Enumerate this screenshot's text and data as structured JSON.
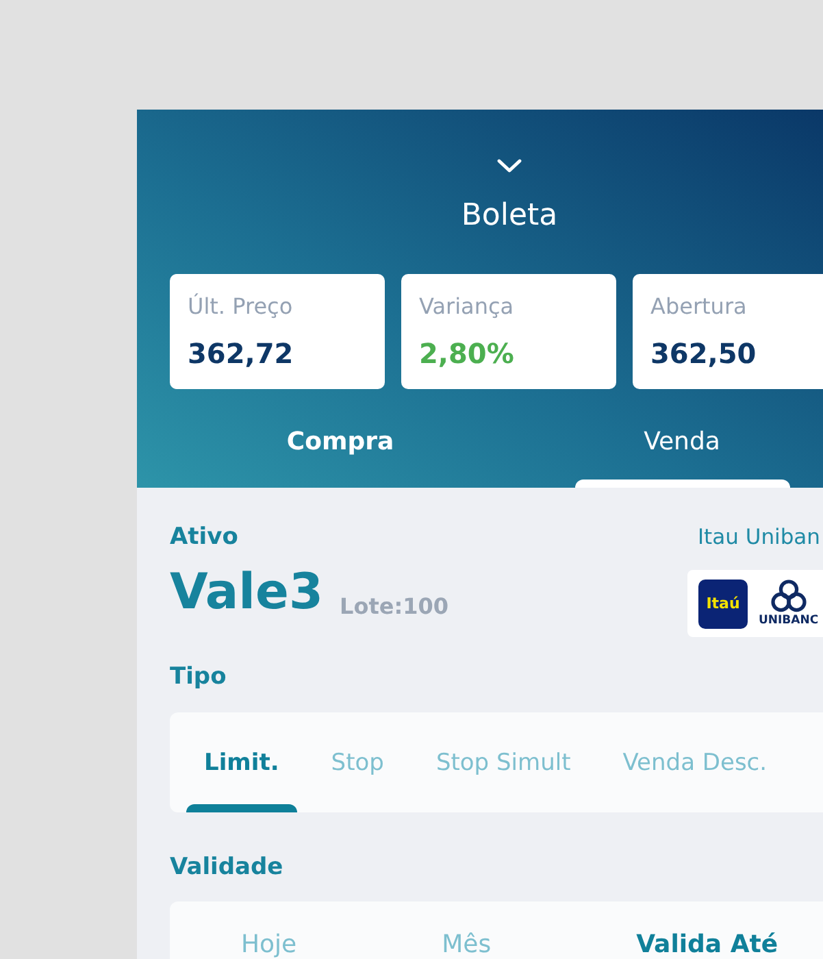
{
  "header": {
    "title": "Boleta"
  },
  "quotes": [
    {
      "label": "Últ. Preço",
      "value": "362,72",
      "kind": "plain"
    },
    {
      "label": "Variança",
      "value": "2,80%",
      "kind": "gain"
    },
    {
      "label": "Abertura",
      "value": "362,50",
      "kind": "plain"
    }
  ],
  "side_tabs": [
    {
      "label": "Compra",
      "selected": true,
      "indicator": false
    },
    {
      "label": "Venda",
      "selected": false,
      "indicator": true
    }
  ],
  "asset": {
    "label": "Ativo",
    "ticker": "Vale3",
    "lot": "Lote:100",
    "broker": "Itau Uniban",
    "broker_logo": {
      "tile_text": "Itaú",
      "wordmark": "UNIBANC"
    }
  },
  "order_type": {
    "label": "Tipo",
    "options": [
      {
        "label": "Limit.",
        "selected": true
      },
      {
        "label": "Stop",
        "selected": false
      },
      {
        "label": "Stop Simult",
        "selected": false
      },
      {
        "label": "Venda Desc.",
        "selected": false
      }
    ]
  },
  "validity": {
    "label": "Validade",
    "options": [
      {
        "label": "Hoje",
        "selected": false
      },
      {
        "label": "Mês",
        "selected": false
      },
      {
        "label": "Valida Até",
        "selected": true
      }
    ]
  }
}
